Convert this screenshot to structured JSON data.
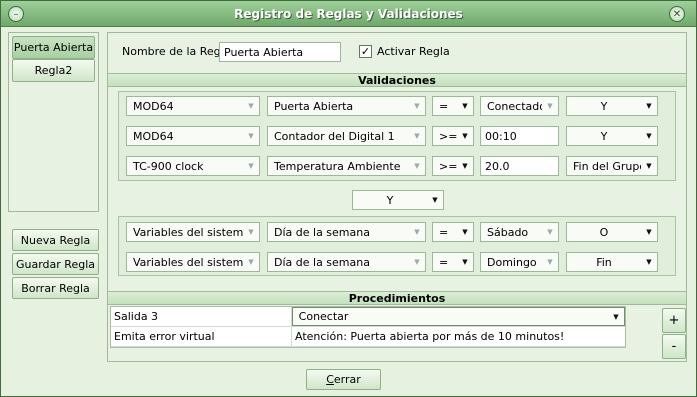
{
  "window": {
    "title": "Registro de Reglas y Validaciones"
  },
  "rules_list": [
    "Puerta Abierta",
    "Regla2"
  ],
  "rule_actions": {
    "new": "Nueva Regla",
    "save": "Guardar Regla",
    "delete": "Borrar Regla"
  },
  "rule_form": {
    "name_label": "Nombre de la Regla:",
    "name_value": "Puerta Abierta",
    "activate_label": "Activar Regla",
    "activate_checked": true
  },
  "validations": {
    "header": "Validaciones",
    "group1": [
      {
        "device": "MOD64",
        "variable": "Puerta Abierta",
        "operator": "=",
        "value": "Conectado",
        "logic": "Y"
      },
      {
        "device": "MOD64",
        "variable": "Contador del Digital 1",
        "operator": ">=",
        "value": "00:10",
        "logic": "Y"
      },
      {
        "device": "TC-900 clock",
        "variable": "Temperatura Ambiente",
        "operator": ">=",
        "value": "20.0",
        "logic": "Fin del Grupo"
      }
    ],
    "group_join": "Y",
    "group2": [
      {
        "device": "Variables del sistema",
        "variable": "Día de la semana",
        "operator": "=",
        "value": "Sábado",
        "logic": "O"
      },
      {
        "device": "Variables del sistema",
        "variable": "Día de la semana",
        "operator": "=",
        "value": "Domingo",
        "logic": "Fin"
      }
    ]
  },
  "procedures": {
    "header": "Procedimientos",
    "rows": [
      {
        "target": "Salida 3",
        "action": "Conectar"
      },
      {
        "target": "Emita error virtual",
        "action": "Atención: Puerta abierta por más de 10 minutos!"
      }
    ],
    "add_label": "+",
    "remove_label": "-"
  },
  "footer": {
    "close_prefix": "C",
    "close_rest": "errar"
  },
  "icons": {
    "minimize": "minimize-icon",
    "close": "close-icon",
    "dropdown": "chevron-down-icon"
  },
  "colors": {
    "accent": "#7fb97a",
    "background": "#e6f1df"
  }
}
